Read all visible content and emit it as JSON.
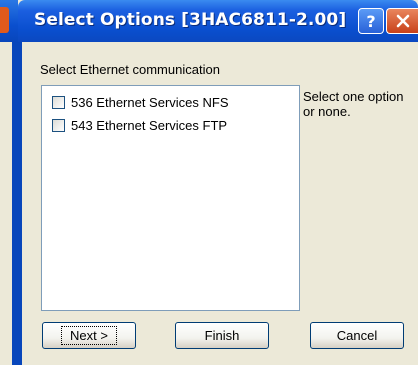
{
  "window": {
    "title": "Select Options [3HAC6811-2.00]",
    "help_glyph": "?",
    "close_icon": "close-icon"
  },
  "content": {
    "prompt": "Select Ethernet communication",
    "options": [
      {
        "label": "536 Ethernet Services NFS",
        "checked": false
      },
      {
        "label": "543 Ethernet Services FTP",
        "checked": false
      }
    ],
    "hint": "Select one option or none."
  },
  "buttons": {
    "next": "Next >",
    "finish": "Finish",
    "cancel": "Cancel"
  },
  "colors": {
    "titlebar": "#0a4fcf",
    "dialog_bg": "#ece9d8",
    "close_button": "#c8411a"
  }
}
